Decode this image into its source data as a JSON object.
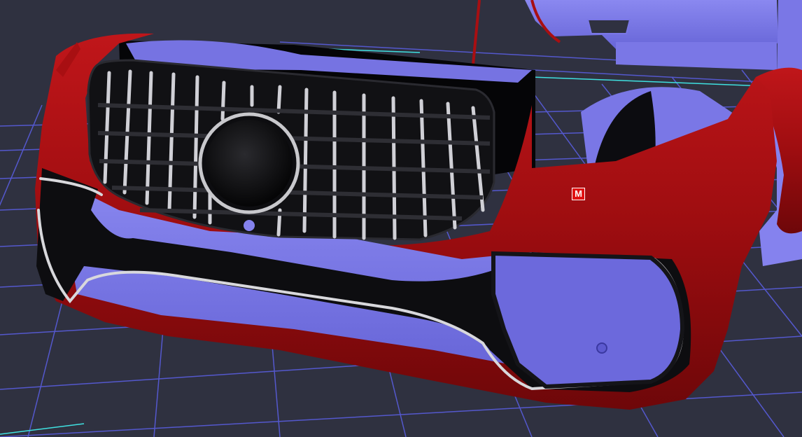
{
  "viewport": {
    "background_color": "#2f3140",
    "grid_color": "#5b5fe6",
    "axis_color": "#3fe0e0",
    "model_body_color": "#a80f12",
    "model_part_color": "#7b78e8",
    "trim_color": "#d8d8dc"
  },
  "marker": {
    "label": "M",
    "color": "#e01010"
  }
}
